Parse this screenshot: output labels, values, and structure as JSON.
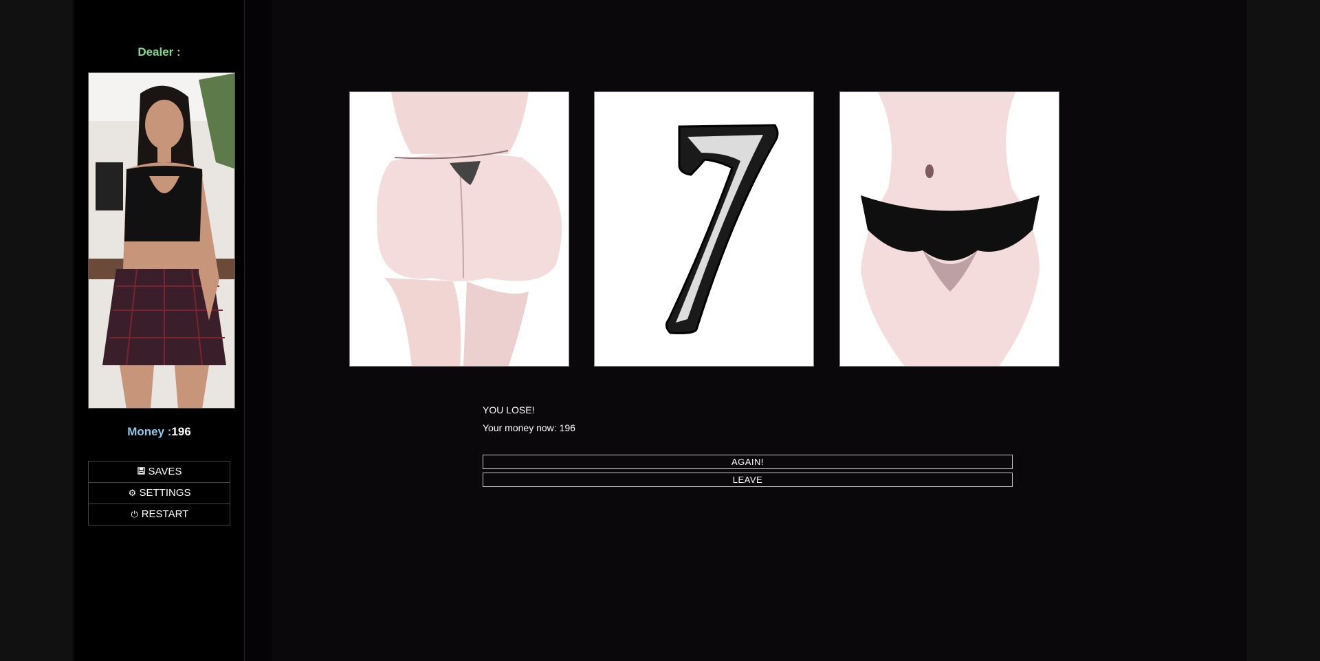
{
  "sidebar": {
    "dealer_label": "Dealer :",
    "money_label": "Money :",
    "money_value": "196",
    "menu": [
      {
        "label": "SAVES",
        "icon": "save-icon"
      },
      {
        "label": "SETTINGS",
        "icon": "gear-icon"
      },
      {
        "label": "RESTART",
        "icon": "power-icon"
      }
    ]
  },
  "reels": [
    {
      "symbol": "back-figure"
    },
    {
      "symbol": "seven"
    },
    {
      "symbol": "front-figure"
    }
  ],
  "result": {
    "title": "YOU LOSE!",
    "money_line": "Your money now: 196"
  },
  "actions": {
    "again_label": "AGAIN!",
    "leave_label": "LEAVE"
  },
  "colors": {
    "dealer_label": "#7fdc8a",
    "money_label": "#8fc8e8",
    "background": "#0b080c"
  }
}
